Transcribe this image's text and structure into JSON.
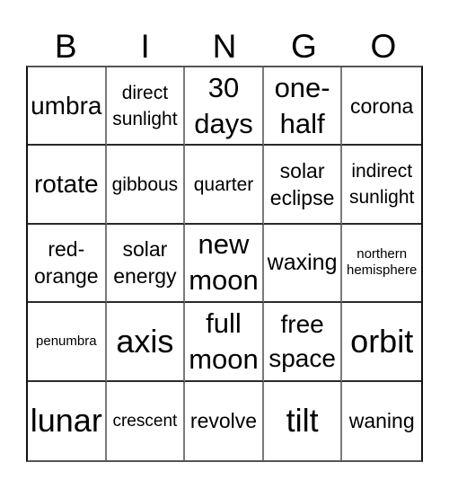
{
  "header": {
    "letters": [
      "B",
      "I",
      "N",
      "G",
      "O"
    ]
  },
  "grid": {
    "rows": [
      [
        "umbra",
        "direct\nsunlight",
        "30\ndays",
        "one-\nhalf",
        "corona"
      ],
      [
        "rotate",
        "gibbous",
        "quarter",
        "solar\neclipse",
        "indirect\nsunlight"
      ],
      [
        "red-\norange",
        "solar\nenergy",
        "new\nmoon",
        "waxing",
        "northern\nhemisphere"
      ],
      [
        "penumbra",
        "axis",
        "full\nmoon",
        "free\nspace",
        "orbit"
      ],
      [
        "lunar",
        "crescent",
        "revolve",
        "tilt",
        "waning"
      ]
    ]
  }
}
